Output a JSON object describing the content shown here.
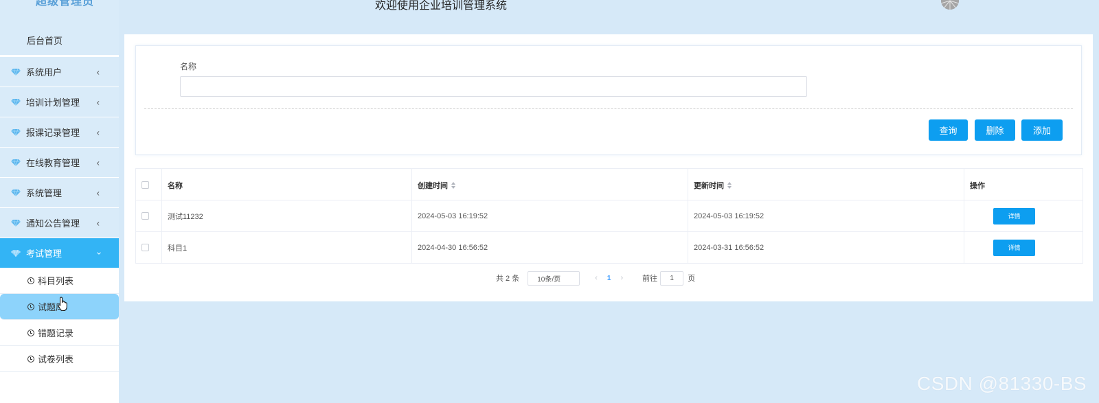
{
  "header": {
    "title": "欢迎使用企业培训管理系统"
  },
  "sidebar": {
    "logo_text": "超级管理员",
    "home": "后台首页",
    "items": [
      {
        "label": "系统用户",
        "icon": "gem-icon"
      },
      {
        "label": "培训计划管理",
        "icon": "gem-icon"
      },
      {
        "label": "报课记录管理",
        "icon": "gem-icon"
      },
      {
        "label": "在线教育管理",
        "icon": "gem-icon"
      },
      {
        "label": "系统管理",
        "icon": "gem-icon"
      },
      {
        "label": "通知公告管理",
        "icon": "gem-icon"
      },
      {
        "label": "考试管理",
        "icon": "gem-icon",
        "active": true
      }
    ],
    "sub_items": [
      {
        "label": "科目列表"
      },
      {
        "label": "试题库",
        "selected": true
      },
      {
        "label": "错题记录"
      },
      {
        "label": "试卷列表"
      }
    ]
  },
  "search": {
    "name_label": "名称",
    "name_value": "",
    "query_label": "查询",
    "delete_label": "删除",
    "add_label": "添加"
  },
  "table": {
    "columns": [
      "名称",
      "创建时间",
      "更新时间",
      "操作"
    ],
    "rows": [
      {
        "name": "测试11232",
        "created": "2024-05-03 16:19:52",
        "updated": "2024-05-03 16:19:52",
        "action": "详情"
      },
      {
        "name": "科目1",
        "created": "2024-04-30 16:56:52",
        "updated": "2024-03-31 16:56:52",
        "action": "详情"
      }
    ]
  },
  "pager": {
    "total": "共 2 条",
    "page_size": "10条/页",
    "current": "1",
    "goto_label": "前往",
    "goto_value": "1",
    "page_suffix": "页"
  },
  "watermark": "CSDN @81330-BS",
  "colors": {
    "primary": "#0d9ef0",
    "sidebar_active": "#33b4f5",
    "background": "#d6e9f8"
  }
}
